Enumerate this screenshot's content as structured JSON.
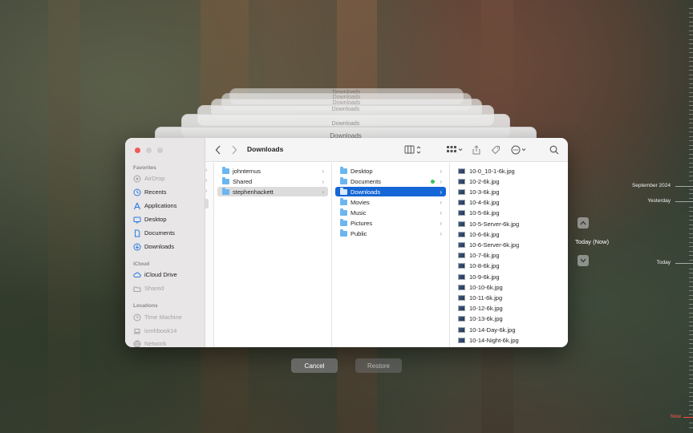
{
  "ghost_windows": [
    {
      "title": "Downloads"
    },
    {
      "title": "Downloads"
    },
    {
      "title": "Downloads"
    },
    {
      "title": "Downloads"
    },
    {
      "title": "Downloads"
    },
    {
      "title": "Downloads"
    }
  ],
  "window": {
    "title": "Downloads",
    "sidebar": {
      "favorites_header": "Favorites",
      "favorites": [
        {
          "label": "AirDrop",
          "dim": true,
          "icon": "airdrop-icon"
        },
        {
          "label": "Recents",
          "dim": false,
          "icon": "clock-icon"
        },
        {
          "label": "Applications",
          "dim": false,
          "icon": "applications-icon"
        },
        {
          "label": "Desktop",
          "dim": false,
          "icon": "desktop-icon"
        },
        {
          "label": "Documents",
          "dim": false,
          "icon": "document-icon"
        },
        {
          "label": "Downloads",
          "dim": false,
          "icon": "download-icon"
        }
      ],
      "icloud_header": "iCloud",
      "icloud": [
        {
          "label": "iCloud Drive",
          "dim": false,
          "icon": "cloud-icon"
        },
        {
          "label": "Shared",
          "dim": true,
          "icon": "shared-folder-icon"
        }
      ],
      "locations_header": "Locations",
      "locations": [
        {
          "label": "Time Machine",
          "dim": true,
          "icon": "time-machine-icon"
        },
        {
          "label": "ismhbook14",
          "dim": true,
          "icon": "laptop-icon"
        },
        {
          "label": "Network",
          "dim": true,
          "icon": "network-icon"
        }
      ]
    },
    "columns": {
      "users": [
        {
          "label": "johnternus"
        },
        {
          "label": "Shared"
        },
        {
          "label": "stephenhackett"
        }
      ],
      "home": [
        {
          "label": "Desktop"
        },
        {
          "label": "Documents"
        },
        {
          "label": "Downloads"
        },
        {
          "label": "Movies"
        },
        {
          "label": "Music"
        },
        {
          "label": "Pictures"
        },
        {
          "label": "Public"
        }
      ],
      "files": [
        "10-0_10-1-6k.jpg",
        "10-2-6k.jpg",
        "10-3-6k.jpg",
        "10-4-6k.jpg",
        "10-5-6k.jpg",
        "10-5-Server-6k.jpg",
        "10-6-6k.jpg",
        "10-6-Server-6k.jpg",
        "10-7-6k.jpg",
        "10-8-6k.jpg",
        "10-9-6k.jpg",
        "10-10-6k.jpg",
        "10-11-6k.jpg",
        "10-12-6k.jpg",
        "10-13-6k.jpg",
        "10-14-Day-6k.jpg",
        "10-14-Night-6k.jpg"
      ]
    },
    "selected_user": "stephenhackett",
    "selected_folder": "Downloads"
  },
  "buttons": {
    "cancel": "Cancel",
    "restore": "Restore"
  },
  "timeline": {
    "current": "Today (Now)",
    "labels": {
      "september": "September 2024",
      "yesterday": "Yesterday",
      "today": "Today",
      "now": "Now"
    }
  },
  "colors": {
    "selection_blue": "#1566d6",
    "close_red": "#ee5b56",
    "now_red": "#ff4a3d",
    "tag_green": "#38c25c"
  }
}
